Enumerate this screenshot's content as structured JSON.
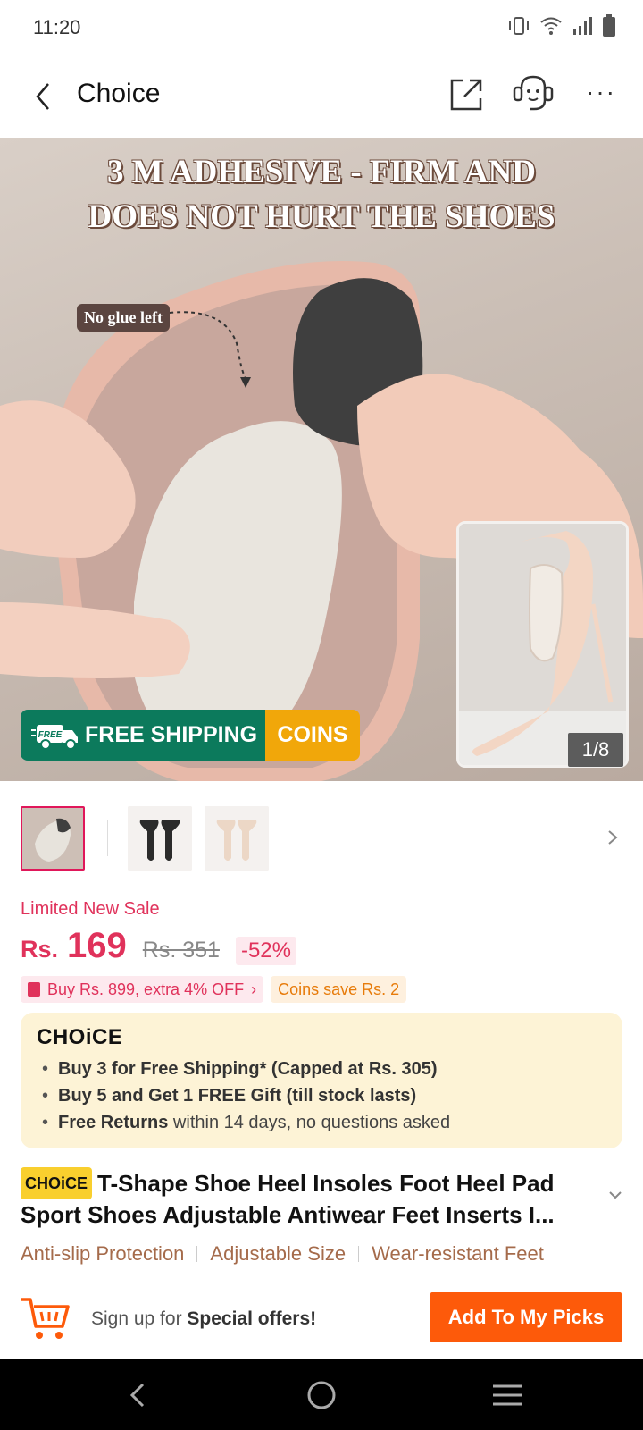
{
  "status_bar": {
    "time": "11:20",
    "icons": [
      "vibrate-icon",
      "wifi-icon",
      "signal-icon",
      "battery-icon"
    ]
  },
  "header": {
    "title": "Choice",
    "icons": [
      "back-icon",
      "share-icon",
      "support-icon",
      "more-icon"
    ],
    "more_label": "···"
  },
  "hero": {
    "headline_line1": "3 M ADHESIVE - FIRM AND",
    "headline_line2": "DOES NOT HURT THE SHOES",
    "glue_label": "No glue left",
    "counter": "1/8",
    "banner_free_badge": "FREE",
    "banner_shipping": "FREE SHIPPING",
    "banner_coins": "COINS"
  },
  "thumbnails": {
    "count_visible": 3,
    "active_index": 0
  },
  "price": {
    "sale_label": "Limited New Sale",
    "currency": "Rs.",
    "current": "169",
    "original": "Rs. 351",
    "discount": "-52%"
  },
  "coupons": {
    "deal": "Buy Rs. 899, extra 4% OFF",
    "coins": "Coins save Rs. 2"
  },
  "choice_box": {
    "logo": "CHOiCE",
    "item1": "Buy 3 for  Free Shipping* (Capped at Rs. 305)",
    "item2": "Buy 5 and Get 1 FREE Gift (till stock lasts)",
    "item3_bold": "Free Returns",
    "item3_rest": " within 14 days, no questions asked"
  },
  "product": {
    "tag": "CHOiCE",
    "title": "T-Shape Shoe Heel Insoles Foot Heel Pad Sport Shoes Adjustable Antiwear Feet Inserts I...",
    "features": [
      "Anti-slip Protection",
      "Adjustable Size",
      "Wear-resistant Feet"
    ]
  },
  "action_bar": {
    "signup_prefix": "Sign up for ",
    "signup_bold": "Special offers!",
    "button": "Add To My Picks"
  },
  "colors": {
    "accent_red": "#e0325b",
    "button_orange": "#fd5a0a",
    "ship_green": "#0c7a5c",
    "coins_gold": "#f1a70a",
    "choice_bg": "#fdf3d6"
  }
}
